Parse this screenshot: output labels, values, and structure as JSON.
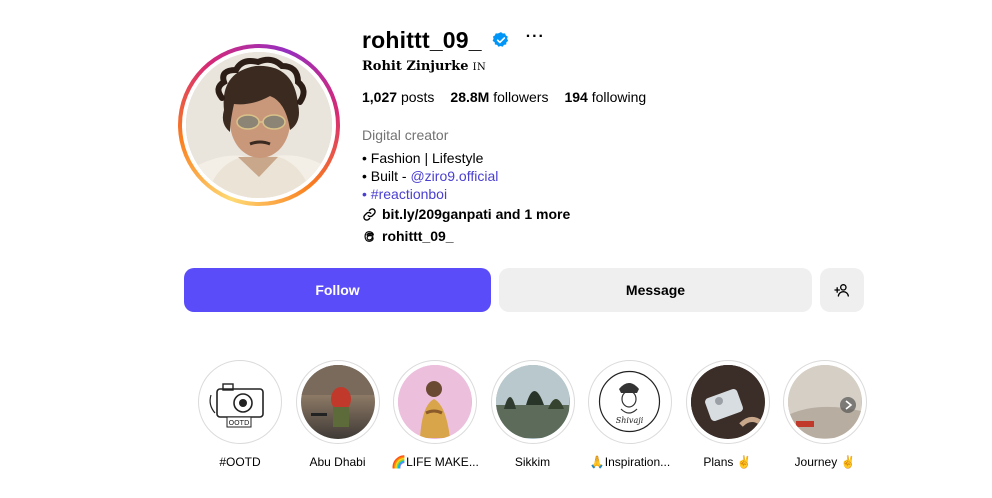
{
  "profile": {
    "username": "rohittt_09_",
    "full_name": "Rohit Zinjurke",
    "pronoun": "IN",
    "verified_icon": "verified-badge-icon",
    "more_icon": "more-options-icon",
    "more_glyph": "···"
  },
  "stats": {
    "posts_count": "1,027",
    "posts_label": "posts",
    "followers_count": "28.8M",
    "followers_label": "followers",
    "following_count": "194",
    "following_label": "following"
  },
  "bio": {
    "category": "Digital creator",
    "line1": "• Fashion | Lifestyle",
    "line2_prefix": "• Built - ",
    "line2_mention": "@ziro9.official",
    "line3_bullet": "• ",
    "line3_hashtag": "#reactionboi",
    "link_text": "bit.ly/209ganpati and 1 more",
    "threads_handle": "rohittt_09_"
  },
  "buttons": {
    "follow": "Follow",
    "message": "Message",
    "add_user_icon": "add-user-icon"
  },
  "highlights": [
    {
      "label": "#OOTD"
    },
    {
      "label": "Abu Dhabi"
    },
    {
      "label": "🌈LIFE MAKE..."
    },
    {
      "label": "Sikkim"
    },
    {
      "label": "🙏Inspiration..."
    },
    {
      "label": "Plans ✌️"
    },
    {
      "label": "Journey ✌️"
    }
  ],
  "highlight_covers": {
    "ootd_overlay_text": "OOTD",
    "shivaji_text": "Shivaji"
  },
  "colors": {
    "follow_button": "#5b4cf9",
    "link_blue": "#4a3fd0",
    "secondary_button": "#efefef",
    "verified_blue": "#0095f6",
    "muted_text": "#737373"
  }
}
